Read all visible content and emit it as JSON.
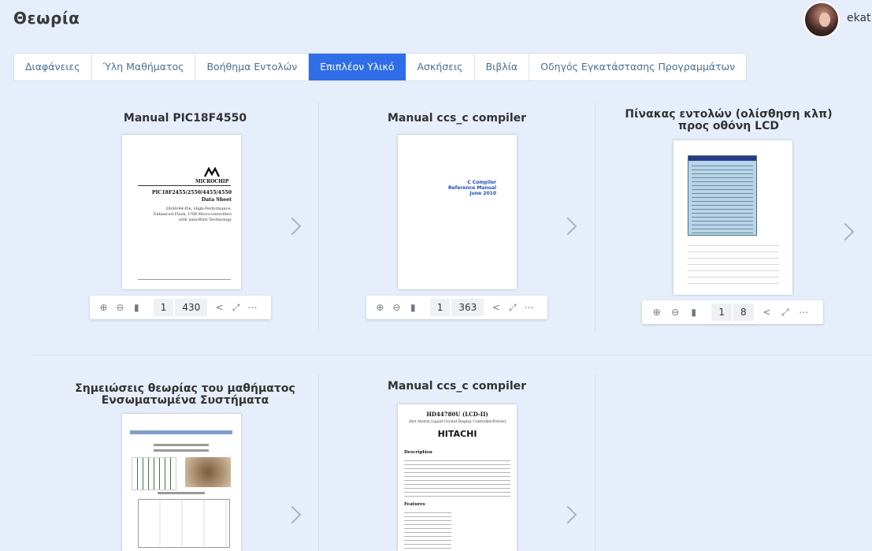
{
  "header": {
    "title": "Θεωρία",
    "username": "ekat"
  },
  "tabs": [
    {
      "label": "Διαφάνειες"
    },
    {
      "label": "Ύλη Μαθήματος"
    },
    {
      "label": "Βοήθημα Εντολών"
    },
    {
      "label": "Επιπλέον Υλικό",
      "active": true
    },
    {
      "label": "Ασκήσεις"
    },
    {
      "label": "Βιβλία"
    },
    {
      "label": "Οδηγός Εγκατάστασης Προγραμμάτων"
    }
  ],
  "cards": [
    {
      "title": "Manual PIC18F4550",
      "doc": {
        "brand": "MICROCHIP",
        "line1": "PIC18F2455/2550/4455/4550",
        "line2": "Data Sheet",
        "line3": "28/40/44-Pin, High-Performance,",
        "line4": "Enhanced Flash, USB Microcontrollers",
        "line5": "with nanoWatt Technology"
      },
      "page": "1",
      "pages": "430"
    },
    {
      "title": "Manual ccs_c compiler",
      "doc": {
        "line1": "C Compiler",
        "line2": "Reference Manual",
        "line3": "June 2010"
      },
      "page": "1",
      "pages": "363"
    },
    {
      "title": "Πίνακας εντολών (ολίσθηση κλπ) προς οθόνη LCD",
      "page": "1",
      "pages": "8"
    },
    {
      "title": "Σημειώσεις θεωρίας του μαθήματος Ενσωματωμένα Συστήματα"
    },
    {
      "title": "Manual ccs_c compiler",
      "doc": {
        "line1": "HD44780U (LCD-II)",
        "line2": "(Dot Matrix Liquid Crystal Display Controller/Driver)",
        "brand": "HITACHI",
        "section1": "Description",
        "section2": "Features"
      }
    }
  ],
  "toolbar_icons": [
    "zoom-in-icon",
    "zoom-out-icon",
    "bookmark-icon",
    "share-icon",
    "fullscreen-icon",
    "more-icon"
  ]
}
